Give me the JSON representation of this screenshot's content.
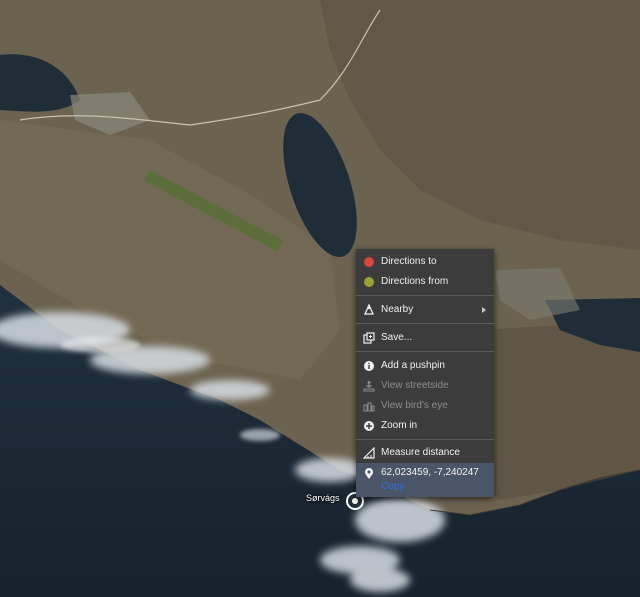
{
  "map": {
    "colors": {
      "terrain": "#6e6552",
      "terrain_dark": "#544c3c",
      "water": "#1f2d38",
      "sea": "#1a2835",
      "cloud": "#d8dee4",
      "green": "#5c6e3a"
    },
    "place_label": "Sørvágs"
  },
  "context_menu": {
    "directions_to": "Directions to",
    "directions_from": "Directions from",
    "nearby": "Nearby",
    "save": "Save...",
    "add_pushpin": "Add a pushpin",
    "view_streetside": "View streetside",
    "view_birds_eye": "View bird's eye",
    "zoom_in": "Zoom in",
    "measure_distance": "Measure distance",
    "coordinates": "62,023459, -7,240247",
    "copy": "Copy",
    "colors": {
      "background": "#3c3c3c",
      "highlight": "#4a5668",
      "directions_to_dot": "#d9463e",
      "directions_from_dot": "#9aa136",
      "link": "#2f6fe4",
      "disabled_text": "#8d8d8d"
    }
  }
}
